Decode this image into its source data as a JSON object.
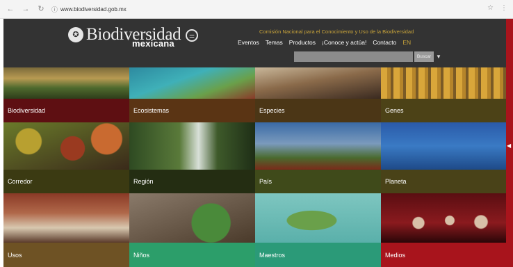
{
  "browser": {
    "url": "www.biodiversidad.gob.mx",
    "back_icon": "arrow-left-icon",
    "forward_icon": "arrow-right-icon",
    "reload_icon": "reload-icon"
  },
  "header": {
    "logo_main": "Biodiversidad",
    "logo_sub": "mexicana",
    "org_name": "Comisión Nacional para el Conocimiento y Uso de la Biodiversidad",
    "menu": [
      "Eventos",
      "Temas",
      "Productos",
      "¡Conoce y actúa!",
      "Contacto"
    ],
    "lang": "EN",
    "search_placeholder": "",
    "search_button": "Buscar"
  },
  "tiles": [
    {
      "label": "Biodiversidad",
      "color": "#5e0f12"
    },
    {
      "label": "Ecosistemas",
      "color": "#5a3414"
    },
    {
      "label": "Especies",
      "color": "#4b3616"
    },
    {
      "label": "Genes",
      "color": "#4c4217"
    },
    {
      "label": "Corredor",
      "color": "#3b3a12"
    },
    {
      "label": "Región",
      "color": "#242d12"
    },
    {
      "label": "País",
      "color": "#3f4a1a"
    },
    {
      "label": "Planeta",
      "color": "#494218"
    },
    {
      "label": "Usos",
      "color": "#6e5224"
    },
    {
      "label": "Niños",
      "color": "#2c9e6a"
    },
    {
      "label": "Maestros",
      "color": "#2b9a78"
    },
    {
      "label": "Medios",
      "color": "#a8141c"
    }
  ],
  "colors": {
    "header_bg": "#333333",
    "accent_gold": "#c9a43a",
    "accent_red": "#a8141c"
  }
}
